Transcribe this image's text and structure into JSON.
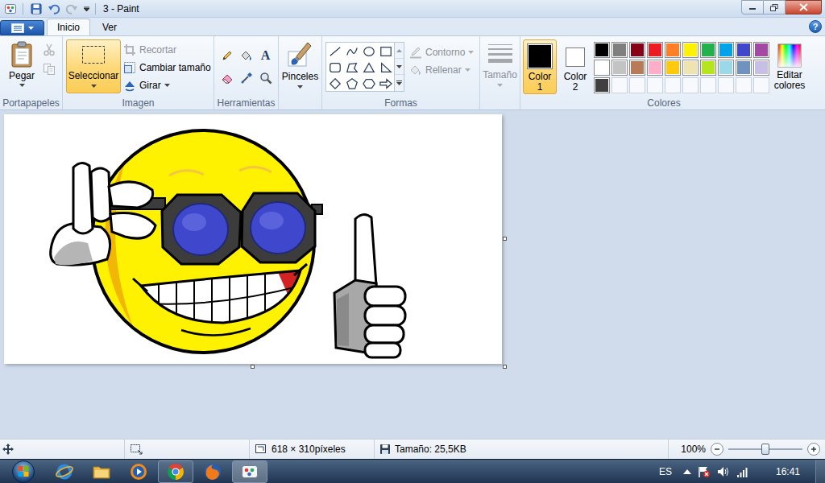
{
  "window": {
    "title": "3 - Paint"
  },
  "quick_access": [
    {
      "disabled": false
    },
    {
      "disabled": false
    },
    {
      "disabled": true
    }
  ],
  "tabs": [
    {
      "label": "Inicio",
      "selected": true
    },
    {
      "label": "Ver",
      "selected": false
    }
  ],
  "help": "?",
  "ribbon": {
    "clipboard": {
      "label": "Portapapeles",
      "paste": "Pegar",
      "tools": [
        {
          "disabled": true
        },
        {
          "disabled": true
        }
      ]
    },
    "image": {
      "label": "Imagen",
      "select": {
        "label": "Seleccionar",
        "selected": true
      },
      "commands": [
        {
          "label": "Recortar",
          "disabled": true
        },
        {
          "label": "Cambiar tamaño",
          "disabled": false
        },
        {
          "label": "Girar",
          "disabled": false
        }
      ]
    },
    "tools": {
      "label": "Herramientas",
      "items": [
        {
          "selected": false
        },
        {
          "selected": false
        },
        {
          "selected": false,
          "glyph": "A"
        },
        {
          "selected": false
        },
        {
          "selected": false
        },
        {
          "selected": false
        }
      ]
    },
    "brushes": {
      "label": "Pinceles"
    },
    "shapes": {
      "label": "Formas",
      "outline": {
        "label": "Contorno",
        "disabled": true
      },
      "fill": {
        "label": "Rellenar",
        "disabled": true
      }
    },
    "size": {
      "label": "Tamaño",
      "disabled": true
    },
    "colors": {
      "label": "Colores",
      "color1": {
        "label": [
          "Color",
          "1"
        ],
        "selected": true,
        "color": "#000000"
      },
      "color2": {
        "label": [
          "Color",
          "2"
        ],
        "selected": false,
        "color": "#ffffff"
      },
      "palette": [
        {
          "kind": "filled",
          "color": "#000000"
        },
        {
          "kind": "filled",
          "color": "#7f7f7f"
        },
        {
          "kind": "filled",
          "color": "#880015"
        },
        {
          "kind": "filled",
          "color": "#ed1c24"
        },
        {
          "kind": "filled",
          "color": "#ff7f27"
        },
        {
          "kind": "filled",
          "color": "#fff200"
        },
        {
          "kind": "filled",
          "color": "#22b14c"
        },
        {
          "kind": "filled",
          "color": "#00a2e8"
        },
        {
          "kind": "filled",
          "color": "#3f48cc"
        },
        {
          "kind": "filled",
          "color": "#a349a4"
        },
        {
          "kind": "filled",
          "color": "#ffffff"
        },
        {
          "kind": "filled",
          "color": "#c3c3c3"
        },
        {
          "kind": "filled",
          "color": "#b97a57"
        },
        {
          "kind": "filled",
          "color": "#ffaec9"
        },
        {
          "kind": "filled",
          "color": "#ffc90e"
        },
        {
          "kind": "filled",
          "color": "#efe4b0"
        },
        {
          "kind": "filled",
          "color": "#b5e61d"
        },
        {
          "kind": "filled",
          "color": "#99d9ea"
        },
        {
          "kind": "filled",
          "color": "#7092be"
        },
        {
          "kind": "filled",
          "color": "#c8bfe7"
        },
        {
          "kind": "filled",
          "color": "#404040"
        },
        {
          "kind": "empty"
        },
        {
          "kind": "empty"
        },
        {
          "kind": "empty"
        },
        {
          "kind": "empty"
        },
        {
          "kind": "empty"
        },
        {
          "kind": "empty"
        },
        {
          "kind": "empty"
        },
        {
          "kind": "empty"
        },
        {
          "kind": "empty"
        }
      ],
      "edit": {
        "label": [
          "Editar",
          "colores"
        ]
      }
    }
  },
  "status_bar": {
    "dimensions": "618 × 310píxeles",
    "file_size": "Tamaño: 25,5KB",
    "zoom": "100%",
    "zoom_level": 0.5
  },
  "taskbar": {
    "apps": [
      {
        "running": false,
        "selected": false
      },
      {
        "running": false,
        "selected": false
      },
      {
        "running": false,
        "selected": false
      },
      {
        "running": true,
        "selected": false
      },
      {
        "running": false,
        "selected": false
      },
      {
        "running": true,
        "selected": true
      }
    ],
    "language": "ES",
    "clock": "16:41"
  }
}
